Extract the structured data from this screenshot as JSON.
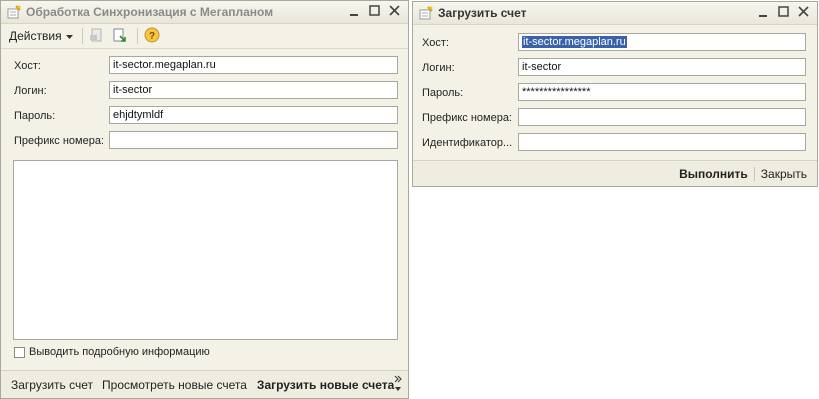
{
  "window1": {
    "title": "Обработка  Синхронизация с Мегапланом",
    "toolbar": {
      "actions_label": "Действия"
    },
    "fields": {
      "host": {
        "label": "Хост:",
        "value": "it-sector.megaplan.ru"
      },
      "login": {
        "label": "Логин:",
        "value": "it-sector"
      },
      "password": {
        "label": "Пароль:",
        "value": "ehjdtymldf"
      },
      "prefix": {
        "label": "Префикс номера:",
        "value": ""
      }
    },
    "checkbox_label": "Выводить подробную информацию",
    "footer": {
      "load_invoice": "Загрузить счет",
      "view_new": "Просмотреть новые счета",
      "load_new": "Загрузить новые счета"
    }
  },
  "window2": {
    "title": "Загрузить счет",
    "fields": {
      "host": {
        "label": "Хост:",
        "value": "it-sector.megaplan.ru"
      },
      "login": {
        "label": "Логин:",
        "value": "it-sector"
      },
      "password": {
        "label": "Пароль:",
        "value": "****************"
      },
      "prefix": {
        "label": "Префикс номера:",
        "value": ""
      },
      "identifier": {
        "label": "Идентификатор...",
        "value": ""
      }
    },
    "footer": {
      "execute": "Выполнить",
      "close": "Закрыть"
    }
  },
  "icons": {
    "window_icon": "form-wand-icon",
    "minimize": "minimize-icon",
    "maximize": "maximize-icon",
    "close": "close-icon",
    "help": "help-icon"
  },
  "colors": {
    "selection": "#3a62a8",
    "background": "#f4f2e6"
  }
}
